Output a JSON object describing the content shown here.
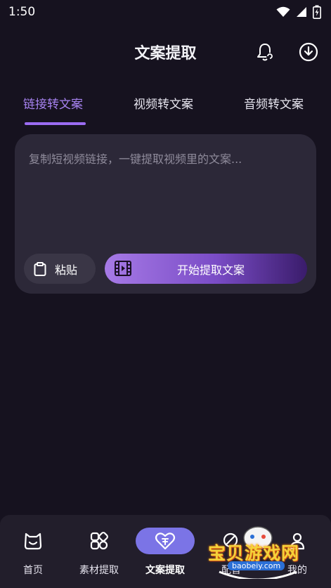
{
  "status_bar": {
    "time": "1:50"
  },
  "header": {
    "title": "文案提取"
  },
  "tabs": [
    {
      "label": "链接转文案",
      "active": true
    },
    {
      "label": "视频转文案",
      "active": false
    },
    {
      "label": "音频转文案",
      "active": false
    }
  ],
  "input_card": {
    "placeholder": "复制短视频链接，一键提取视频里的文案...",
    "paste_label": "粘贴",
    "extract_label": "开始提取文案"
  },
  "bottom_nav": [
    {
      "label": "首页",
      "icon": "home-face-icon",
      "active": false
    },
    {
      "label": "素材提取",
      "icon": "material-icon",
      "active": false
    },
    {
      "label": "文案提取",
      "icon": "text-extract-icon",
      "active": true
    },
    {
      "label": "配音",
      "icon": "voice-icon",
      "active": false
    },
    {
      "label": "我的",
      "icon": "user-icon",
      "active": false
    }
  ],
  "watermark": {
    "text": "宝贝游戏网",
    "url": "baobeiy.com"
  },
  "colors": {
    "background": "#16121f",
    "card": "#2c2838",
    "accent": "#a682f0",
    "nav_active": "#7b74e6"
  }
}
